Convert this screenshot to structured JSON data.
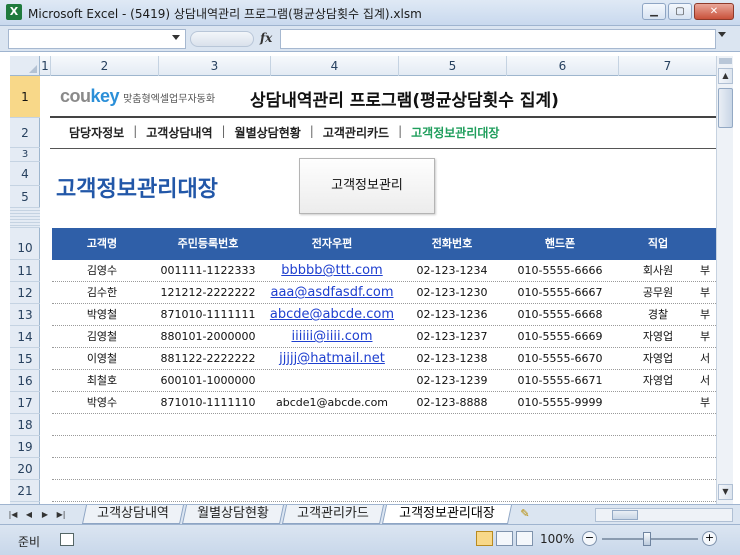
{
  "window": {
    "app_icon": "X",
    "title": "Microsoft Excel - (5419) 상담내역관리 프로그램(평균상담횟수 집계).xlsm",
    "min": "▁",
    "max": "▢",
    "close": "✕"
  },
  "formula_bar": {
    "fx": "fx",
    "name_box_value": "",
    "formula_value": ""
  },
  "columns": [
    "1",
    "2",
    "3",
    "4",
    "5",
    "6",
    "7"
  ],
  "rows": [
    "1",
    "2",
    "3",
    "4",
    "5",
    "10",
    "11",
    "12",
    "13",
    "14",
    "15",
    "16",
    "17",
    "18",
    "19",
    "20",
    "21"
  ],
  "header": {
    "logo_cou": "cou",
    "logo_key": "key",
    "logo_tagline": "맞춤형엑셀업무자동화",
    "title": "상담내역관리 프로그램(평균상담횟수 집계)"
  },
  "nav": [
    {
      "label": "담당자정보"
    },
    {
      "label": "고객상담내역"
    },
    {
      "label": "월별상담현황"
    },
    {
      "label": "고객관리카드"
    },
    {
      "label": "고객정보관리대장"
    }
  ],
  "nav_separator": "|",
  "section": {
    "title": "고객정보관리대장",
    "manage_button": "고객정보관리"
  },
  "table": {
    "headers": [
      "고객명",
      "주민등록번호",
      "전자우편",
      "전화번호",
      "핸드폰",
      "직업"
    ],
    "rows": [
      {
        "name": "김영수",
        "rrn": "001111-1122333",
        "email": "bbbbb@ttt.com",
        "phone": "02-123-1234",
        "mobile": "010-5555-6666",
        "job": "회사원",
        "extra": "부"
      },
      {
        "name": "김수한",
        "rrn": "121212-2222222",
        "email": "aaa@asdfasdf.com",
        "phone": "02-123-1230",
        "mobile": "010-5555-6667",
        "job": "공무원",
        "extra": "부"
      },
      {
        "name": "박영철",
        "rrn": "871010-1111111",
        "email": "abcde@abcde.com",
        "phone": "02-123-1236",
        "mobile": "010-5555-6668",
        "job": "경찰",
        "extra": "부"
      },
      {
        "name": "김영철",
        "rrn": "880101-2000000",
        "email": "iiiiii@iiii.com",
        "phone": "02-123-1237",
        "mobile": "010-5555-6669",
        "job": "자영업",
        "extra": "부"
      },
      {
        "name": "이영철",
        "rrn": "881122-2222222",
        "email": "jjjjj@hatmail.net",
        "phone": "02-123-1238",
        "mobile": "010-5555-6670",
        "job": "자영업",
        "extra": "서"
      },
      {
        "name": "최철호",
        "rrn": "600101-1000000",
        "email": "",
        "phone": "02-123-1239",
        "mobile": "010-5555-6671",
        "job": "자영업",
        "extra": "서"
      },
      {
        "name": "박영수",
        "rrn": "871010-1111110",
        "email": "abcde1@abcde.com",
        "phone": "02-123-8888",
        "mobile": "010-5555-9999",
        "job": "",
        "extra": "부"
      }
    ]
  },
  "sheet_tabs": [
    "고객상담내역",
    "월별상담현황",
    "고객관리카드",
    "고객정보관리대장"
  ],
  "active_sheet": "고객정보관리대장",
  "status": {
    "ready": "준비",
    "zoom": "100%",
    "zoom_minus": "−",
    "zoom_plus": "+"
  }
}
